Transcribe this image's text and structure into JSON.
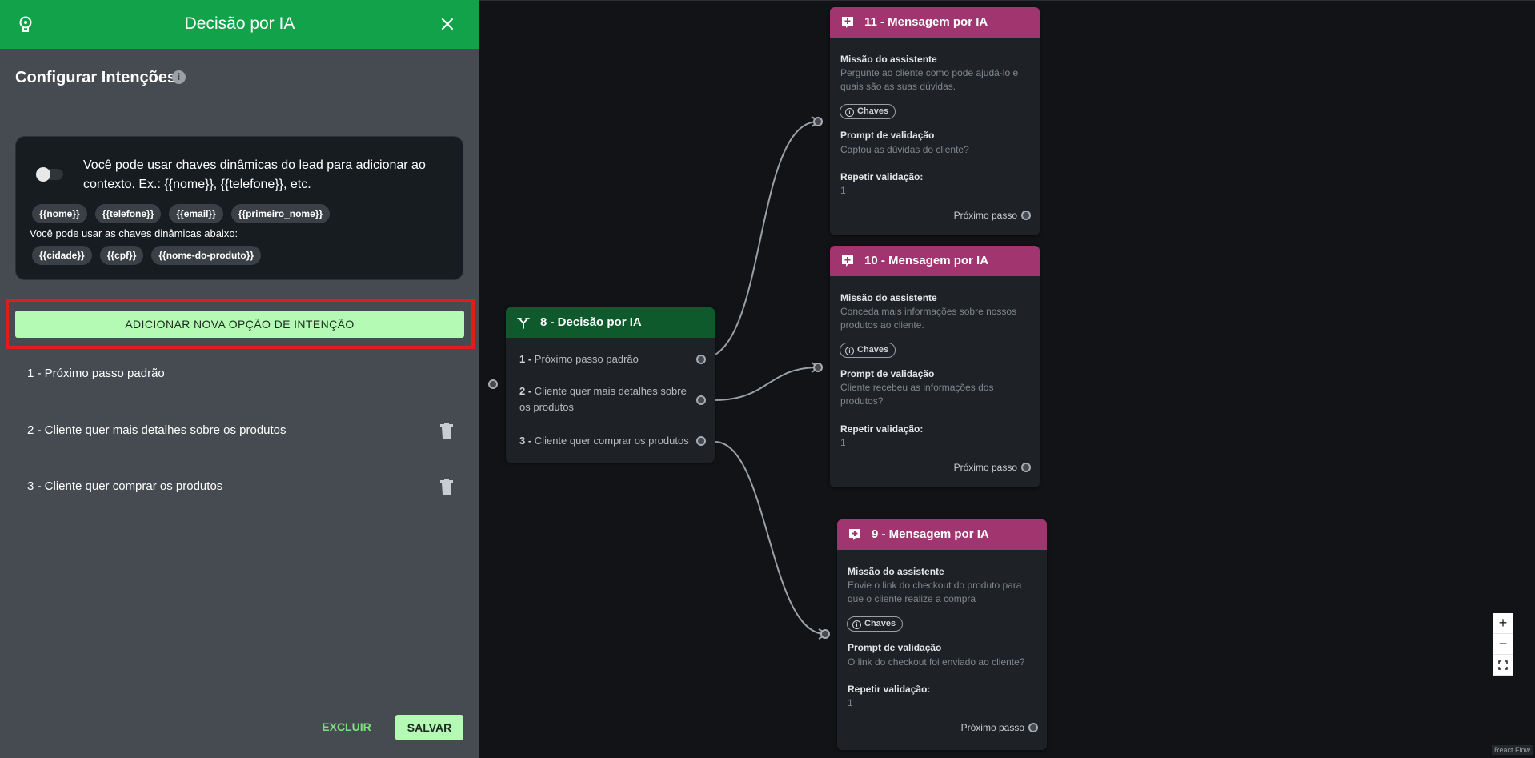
{
  "panel": {
    "title": "Decisão por IA",
    "section_title": "Configurar Intenções",
    "info_glyph": "i",
    "keys_description": "Você pode usar chaves dinâmicas do lead para adicionar ao contexto. Ex.: {{nome}}, {{telefone}}, etc.",
    "default_keys": [
      "{{nome}}",
      "{{telefone}}",
      "{{email}}",
      "{{primeiro_nome}}"
    ],
    "keys_subtitle": "Você pode usar as chaves dinâmicas abaixo:",
    "extra_keys": [
      "{{cidade}}",
      "{{cpf}}",
      "{{nome-do-produto}}"
    ],
    "add_button": "ADICIONAR NOVA OPÇÃO DE INTENÇÃO",
    "intents": [
      "1 - Próximo passo padrão",
      "2 - Cliente quer mais detalhes sobre os produtos",
      "3 - Cliente quer comprar os produtos"
    ],
    "delete_button": "EXCLUIR",
    "save_button": "SALVAR",
    "toggle_on": false,
    "colors": {
      "header": "#12a24a",
      "accent": "#b4f9b4",
      "highlight": "#e01c1c"
    }
  },
  "canvas": {
    "decision_node": {
      "title": "8 - Decisão por IA",
      "items": [
        {
          "num": "1 -",
          "text": "Próximo passo padrão"
        },
        {
          "num": "2 -",
          "text": "Cliente quer mais detalhes sobre os produtos"
        },
        {
          "num": "3 -",
          "text": "Cliente quer comprar os produtos"
        }
      ]
    },
    "message_nodes": [
      {
        "title": "11 - Mensagem por IA",
        "mission_label": "Missão do assistente",
        "mission": "Pergunte ao cliente como pode ajudá-lo e quais são as suas dúvidas.",
        "chaves": "Chaves",
        "prompt_label": "Prompt de validação",
        "prompt": "Captou as dúvidas do cliente?",
        "repeat_label": "Repetir validação:",
        "repeat": "1",
        "next": "Próximo passo"
      },
      {
        "title": "10 - Mensagem por IA",
        "mission_label": "Missão do assistente",
        "mission": "Conceda mais informações sobre nossos produtos ao cliente.",
        "chaves": "Chaves",
        "prompt_label": "Prompt de validação",
        "prompt": "Cliente recebeu as informações dos produtos?",
        "repeat_label": "Repetir validação:",
        "repeat": "1",
        "next": "Próximo passo"
      },
      {
        "title": "9 - Mensagem por IA",
        "mission_label": "Missão do assistente",
        "mission": "Envie o link do checkout do produto para que o cliente realize a compra",
        "chaves": "Chaves",
        "prompt_label": "Prompt de validação",
        "prompt": "O link do checkout foi enviado ao cliente?",
        "repeat_label": "Repetir validação:",
        "repeat": "1",
        "next": "Próximo passo"
      }
    ],
    "zoom": {
      "in": "+",
      "out": "−"
    },
    "attribution": "React Flow"
  }
}
